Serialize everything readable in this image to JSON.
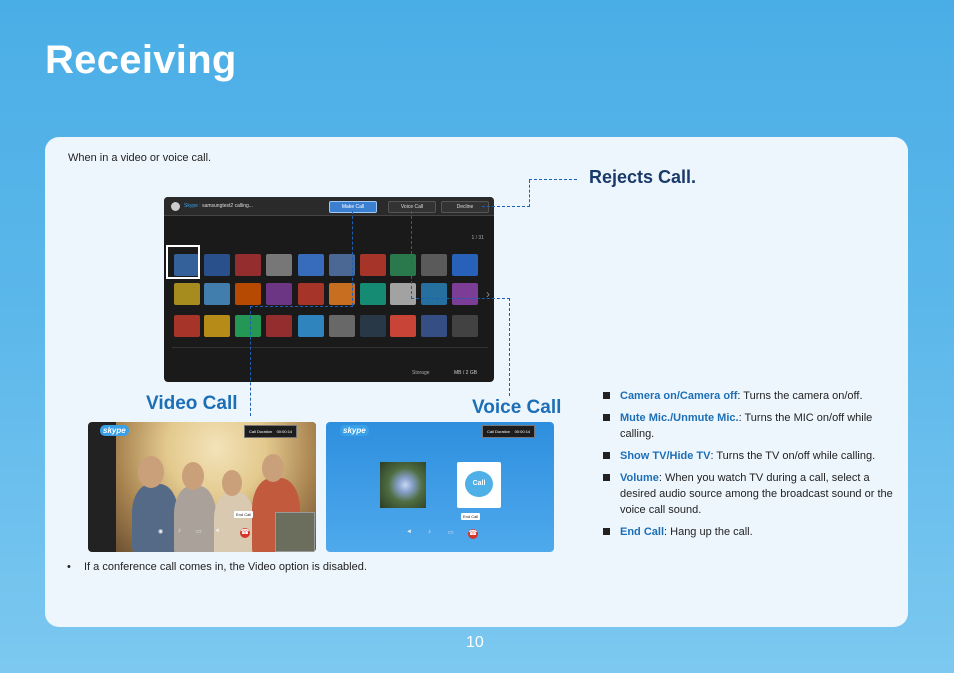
{
  "title": "Receiving",
  "intro": "When in a video or voice call.",
  "labels": {
    "rejects": "Rejects Call.",
    "video_call": "Video Call",
    "voice_call": "Voice Call"
  },
  "tv": {
    "caller_prefix": "Skype :",
    "caller_text": "samsungtest2 calling...",
    "buttons": [
      "Make Call",
      "Voice Call",
      "Decline"
    ],
    "page": "1 / 31",
    "storage_label": "Storage",
    "storage_value": "MB / 2 GB"
  },
  "video_panel": {
    "skype_logo": "skype",
    "duration_label": "Call Duration",
    "duration": "00:00:14",
    "end_tip": "End Call"
  },
  "voice_panel": {
    "skype_logo": "skype",
    "duration_label": "Call Duration",
    "duration": "00:00:14",
    "end_tip": "End Call",
    "avatar_text": "Call"
  },
  "bullets": [
    {
      "term": "Camera on/Camera off",
      "desc": ": Turns the camera on/off."
    },
    {
      "term": "Mute Mic./Unmute Mic.",
      "desc": ": Turns the MIC on/off while calling."
    },
    {
      "term": "Show TV/Hide TV",
      "desc": ": Turns the TV on/off while calling."
    },
    {
      "term": "Volume",
      "desc": ": When you watch TV during a call,  select a desired audio source among the broadcast sound or the voice call sound."
    },
    {
      "term": "End Call",
      "desc": ": Hang up the call."
    }
  ],
  "note": {
    "bullet": "•",
    "text": "If a conference call comes in, the Video option is disabled."
  },
  "page_number": "10",
  "colors": {
    "background": "#5bb7ea",
    "panel": "#eef6fd",
    "accent": "#1c6fb7",
    "end_call": "#d6332a"
  }
}
